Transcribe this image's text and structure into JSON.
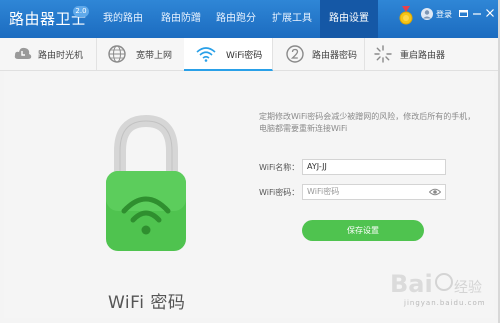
{
  "app": {
    "title": "路由器卫士",
    "version": "2.0"
  },
  "nav": {
    "items": [
      {
        "label": "我的路由"
      },
      {
        "label": "路由防蹭"
      },
      {
        "label": "路由跑分"
      },
      {
        "label": "扩展工具"
      },
      {
        "label": "路由设置"
      }
    ],
    "active_index": 4,
    "login_label": "登录"
  },
  "tabs": {
    "items": [
      {
        "label": "路由时光机",
        "icon": "cloud-clock-icon"
      },
      {
        "label": "宽带上网",
        "icon": "globe-icon"
      },
      {
        "label": "WiFi密码",
        "icon": "wifi-icon"
      },
      {
        "label": "路由器密码",
        "icon": "router-password-icon"
      },
      {
        "label": "重启路由器",
        "icon": "restart-icon"
      }
    ],
    "active_index": 2
  },
  "main": {
    "lock_caption": "WiFi 密码",
    "tip": "定期修改WiFi密码会减少被蹭网的风险，修改后所有的手机，电脑都需要重新连接WiFi",
    "name_label": "WiFi名称：",
    "name_value": "AYJ-JJ",
    "password_label": "WiFi密码：",
    "password_placeholder": "WiFi密码",
    "save_label": "保存设置"
  },
  "watermark": {
    "text": "jingyan.baidu.com"
  },
  "colors": {
    "titlebar": "#1c6cc0",
    "accent_green": "#4fc34f",
    "tab_underline": "#29a0e8"
  }
}
